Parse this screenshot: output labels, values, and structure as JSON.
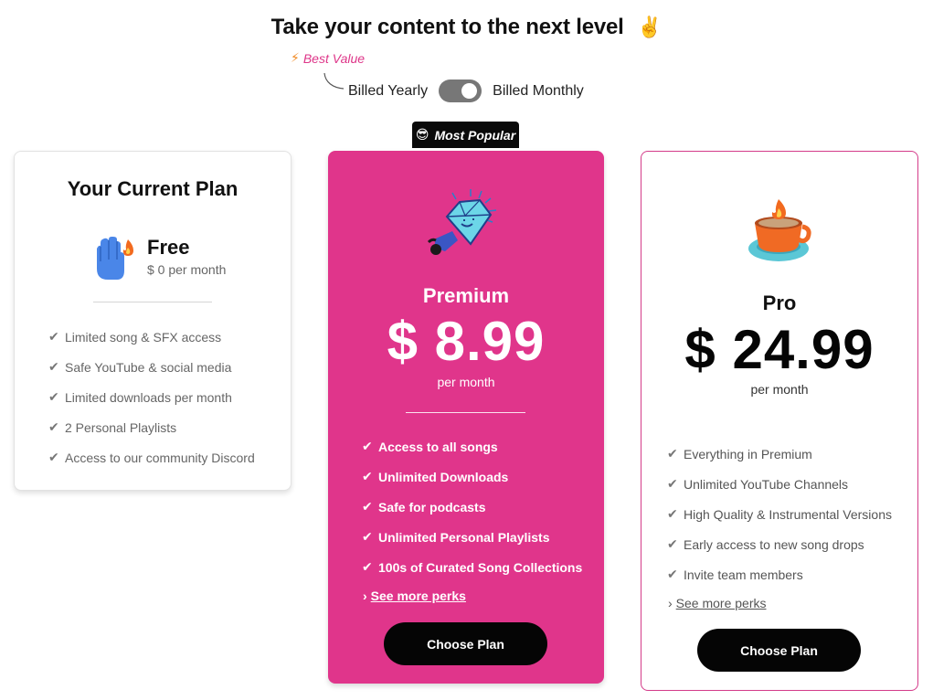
{
  "header": {
    "title": "Take your content to the next level",
    "title_icon": "victory-hand-icon"
  },
  "billing": {
    "best_value": "Best Value",
    "yearly_label": "Billed Yearly",
    "monthly_label": "Billed Monthly"
  },
  "popular_tag": {
    "label": "Most Popular",
    "icon": "sunglasses-face-icon"
  },
  "free": {
    "heading": "Your Current Plan",
    "name": "Free",
    "price": "$ 0 per month",
    "features": [
      "Limited song & SFX access",
      "Safe YouTube & social media",
      "Limited downloads per month",
      "2 Personal Playlists",
      "Access to our community Discord"
    ]
  },
  "premium": {
    "name": "Premium",
    "price": "$ 8.99",
    "period": "per month",
    "features": [
      "Access to all songs",
      "Unlimited Downloads",
      "Safe for podcasts",
      "Unlimited Personal Playlists",
      "100s of Curated Song Collections"
    ],
    "perks_link": "See more perks",
    "button": "Choose Plan"
  },
  "pro": {
    "name": "Pro",
    "price": "$ 24.99",
    "period": "per month",
    "features": [
      "Everything in Premium",
      "Unlimited YouTube Channels",
      "High Quality & Instrumental Versions",
      "Early access to new song drops",
      "Invite team members"
    ],
    "perks_link": "See more perks",
    "button": "Choose Plan"
  },
  "colors": {
    "accent_pink": "#e0358b",
    "button_black": "#050505",
    "toggle_gray": "#777777"
  }
}
